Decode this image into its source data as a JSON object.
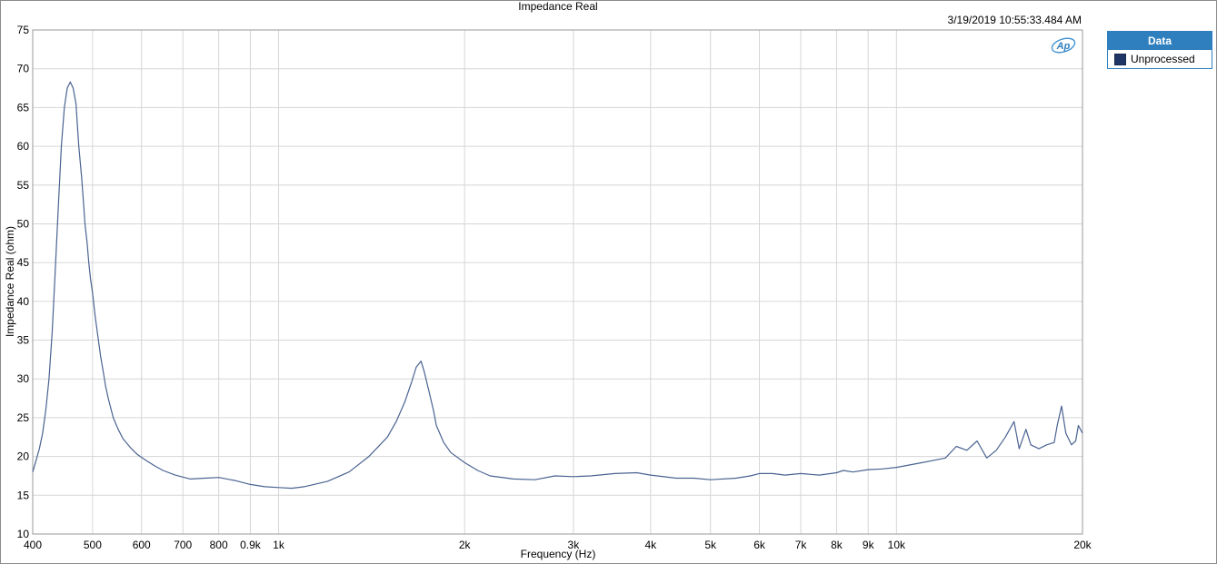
{
  "chart_data": {
    "type": "line",
    "title": "Impedance Real",
    "timestamp": "3/19/2019 10:55:33.484 AM",
    "logo": "Ap",
    "xlabel": "Frequency (Hz)",
    "ylabel": "Impedance Real (ohm)",
    "x_scale": "log",
    "xlim": [
      400,
      20000
    ],
    "ylim": [
      10,
      75
    ],
    "grid": true,
    "x_ticks": [
      {
        "value": 400,
        "label": "400"
      },
      {
        "value": 500,
        "label": "500"
      },
      {
        "value": 600,
        "label": "600"
      },
      {
        "value": 700,
        "label": "700"
      },
      {
        "value": 800,
        "label": "800"
      },
      {
        "value": 900,
        "label": "0.9k"
      },
      {
        "value": 1000,
        "label": "1k"
      },
      {
        "value": 2000,
        "label": "2k"
      },
      {
        "value": 3000,
        "label": "3k"
      },
      {
        "value": 4000,
        "label": "4k"
      },
      {
        "value": 5000,
        "label": "5k"
      },
      {
        "value": 6000,
        "label": "6k"
      },
      {
        "value": 7000,
        "label": "7k"
      },
      {
        "value": 8000,
        "label": "8k"
      },
      {
        "value": 9000,
        "label": "9k"
      },
      {
        "value": 10000,
        "label": "10k"
      },
      {
        "value": 20000,
        "label": "20k"
      }
    ],
    "y_ticks": [
      10,
      15,
      20,
      25,
      30,
      35,
      40,
      45,
      50,
      55,
      60,
      65,
      70,
      75
    ],
    "legend": {
      "title": "Data",
      "position": "right",
      "entries": [
        {
          "name": "Unprocessed",
          "color": "#1f3566"
        }
      ]
    },
    "series": [
      {
        "name": "Unprocessed",
        "color": "#4a6391",
        "x": [
          400,
          405,
          410,
          415,
          420,
          425,
          430,
          435,
          440,
          445,
          450,
          455,
          460,
          465,
          470,
          475,
          480,
          483,
          486,
          490,
          493,
          496,
          500,
          505,
          510,
          515,
          520,
          525,
          530,
          540,
          550,
          560,
          575,
          590,
          610,
          630,
          650,
          680,
          720,
          760,
          800,
          850,
          900,
          950,
          1000,
          1050,
          1100,
          1200,
          1300,
          1400,
          1500,
          1550,
          1600,
          1640,
          1670,
          1700,
          1720,
          1750,
          1780,
          1800,
          1850,
          1900,
          2000,
          2100,
          2200,
          2400,
          2600,
          2800,
          3000,
          3200,
          3500,
          3800,
          4000,
          4400,
          4700,
          5000,
          5500,
          5800,
          6000,
          6300,
          6600,
          7000,
          7500,
          8000,
          8200,
          8500,
          9000,
          9500,
          10000,
          11000,
          12000,
          12500,
          13000,
          13500,
          14000,
          14500,
          15000,
          15500,
          15800,
          16200,
          16500,
          17000,
          17500,
          18000,
          18200,
          18500,
          18800,
          19200,
          19500,
          19700,
          20000
        ],
        "y": [
          18.0,
          19.5,
          21.0,
          23.0,
          26.0,
          30.0,
          36.0,
          44.0,
          52.0,
          60.0,
          65.0,
          67.5,
          68.3,
          67.5,
          65.5,
          60.0,
          56.0,
          53.0,
          50.0,
          47.5,
          45.0,
          43.0,
          41.0,
          38.0,
          35.5,
          33.0,
          31.0,
          29.0,
          27.5,
          25.0,
          23.5,
          22.3,
          21.2,
          20.3,
          19.5,
          18.8,
          18.2,
          17.6,
          17.1,
          17.2,
          17.3,
          16.9,
          16.4,
          16.1,
          16.0,
          15.9,
          16.1,
          16.8,
          18.0,
          20.0,
          22.5,
          24.5,
          27.0,
          29.5,
          31.5,
          32.3,
          31.0,
          28.5,
          26.0,
          24.0,
          21.8,
          20.5,
          19.2,
          18.2,
          17.5,
          17.1,
          17.0,
          17.5,
          17.4,
          17.5,
          17.8,
          17.9,
          17.6,
          17.2,
          17.2,
          17.0,
          17.2,
          17.5,
          17.8,
          17.8,
          17.6,
          17.8,
          17.6,
          17.9,
          18.2,
          18.0,
          18.3,
          18.4,
          18.6,
          19.2,
          19.8,
          21.3,
          20.8,
          22.0,
          19.8,
          20.8,
          22.5,
          24.5,
          21.0,
          23.5,
          21.5,
          21.0,
          21.5,
          21.8,
          24.0,
          26.5,
          23.0,
          21.5,
          22.0,
          24.0,
          23.0
        ]
      }
    ]
  }
}
